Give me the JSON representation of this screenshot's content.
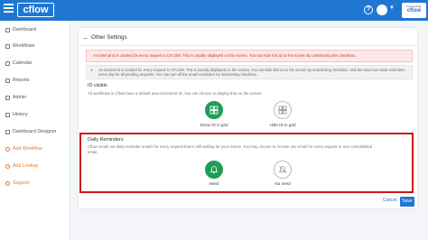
{
  "header": {
    "logo_text": "cflow",
    "help_icon": "question-circle-icon",
    "brand_badge_small": "Powered By",
    "brand_badge_big": "cflow",
    "brand_color": "#1f77d3"
  },
  "sidebar": {
    "items": [
      {
        "label": "Dashboard",
        "icon": "dashboard-icon"
      },
      {
        "label": "Workflows",
        "icon": "workflow-icon"
      },
      {
        "label": "Calendar",
        "icon": "calendar-icon"
      },
      {
        "label": "Reports",
        "icon": "reports-icon"
      },
      {
        "label": "Admin",
        "icon": "admin-icon"
      },
      {
        "label": "History",
        "icon": "history-icon"
      },
      {
        "label": "Dashboard Designer",
        "icon": "designer-icon"
      },
      {
        "label": "Add Workflow",
        "icon": "add-workflow-icon",
        "accent": true
      },
      {
        "label": "Add Lookup",
        "icon": "add-lookup-icon",
        "accent": true
      },
      {
        "label": "Support",
        "icon": "support-icon",
        "accent": true
      }
    ]
  },
  "main": {
    "title": "Other Settings",
    "alert_text": "An internal id is created for every request in CFLOW. This is usually displayed on the screen. You can hide this id on the screen by unselecting this checkbox.",
    "info_text": "An internal id is created for every request in CFLOW. This is usually displayed on the screen. You can hide this id on the screen by unselecting checkbox. and We send out email reminders every day for all pending requests. You can turn off the email reminders by unselecting checkbox.",
    "id_visible": {
      "title": "ID visible",
      "description": "All workflows in Cflow have a default auto-increment ID. You can choose to display that on the screen.",
      "options": [
        {
          "label": "Show ID in grid",
          "selected": true,
          "icon": "grid-icon"
        },
        {
          "label": "Hide ID in grid",
          "selected": false,
          "icon": "grid-icon"
        }
      ]
    },
    "daily_reminders": {
      "title": "Daily Reminders",
      "description_line1": "Cflow sends out daily reminder emails for every request that is still waiting for your review. You may choose to receive one email for every request or one consolidated",
      "description_line2": "email.",
      "options": [
        {
          "label": "Need",
          "selected": true,
          "icon": "bell-icon"
        },
        {
          "label": "No need",
          "selected": false,
          "icon": "bell-off-icon"
        }
      ]
    },
    "cancel_label": "Cancel",
    "save_label": "Save"
  }
}
